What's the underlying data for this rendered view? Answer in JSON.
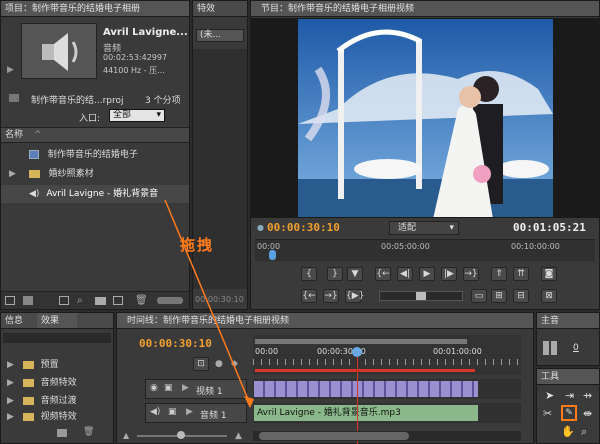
{
  "project": {
    "tab_title": "项目：制作带音乐的结婚电子相册",
    "clip_name": "Avril Lavigne...",
    "clip_type": "音频",
    "clip_duration": "00:02:53:42997",
    "clip_format": "44100 Hz - 压...",
    "project_file": "制作带音乐的结...rproj",
    "item_count": "3 个分项",
    "in_label": "入口:",
    "in_value": "全部",
    "col_name": "名称",
    "items": [
      {
        "label": "制作带音乐的结婚电子"
      },
      {
        "label": "婚纱照素材"
      },
      {
        "label": "Avril Lavigne - 婚礼背景音"
      }
    ]
  },
  "effects_small": {
    "tab": "特效",
    "dropdown": "(未..."
  },
  "program": {
    "tab_title": "节目：制作带音乐的结婚电子相册视频",
    "timecode_current": "00:00:30:10",
    "fit_label": "适配",
    "timecode_total": "00:01:05:21",
    "ruler_labels": [
      "00:00",
      "00:05:00:00",
      "00:10:00:00"
    ],
    "bottom_tc": "00:00:30:10"
  },
  "info_tabs": {
    "info": "信息",
    "effects": "效果",
    "folders": [
      {
        "label": "预置"
      },
      {
        "label": "音频特效"
      },
      {
        "label": "音频过渡"
      },
      {
        "label": "视频特效"
      }
    ]
  },
  "timeline": {
    "tab_title": "时间线：制作带音乐的结婚电子相册视频",
    "timecode": "00:00:30:10",
    "ruler_labels": [
      "00:00",
      "00:00:30:00",
      "00:01:00:00"
    ],
    "video_track": "视频 1",
    "audio_track": "音频 1",
    "audio_clip": "Avril Lavigne - 婚礼背景音乐.mp3"
  },
  "master": {
    "tab": "主音",
    "value": "0"
  },
  "tools": {
    "tab": "工具"
  },
  "annotation": {
    "drag_label": "拖拽"
  },
  "colors": {
    "accent_orange": "#f0a030",
    "annotation": "#ff7a1a",
    "audio_clip": "#8ab88a",
    "video_clip": "#9a8fcf",
    "playhead": "#d8362a"
  }
}
